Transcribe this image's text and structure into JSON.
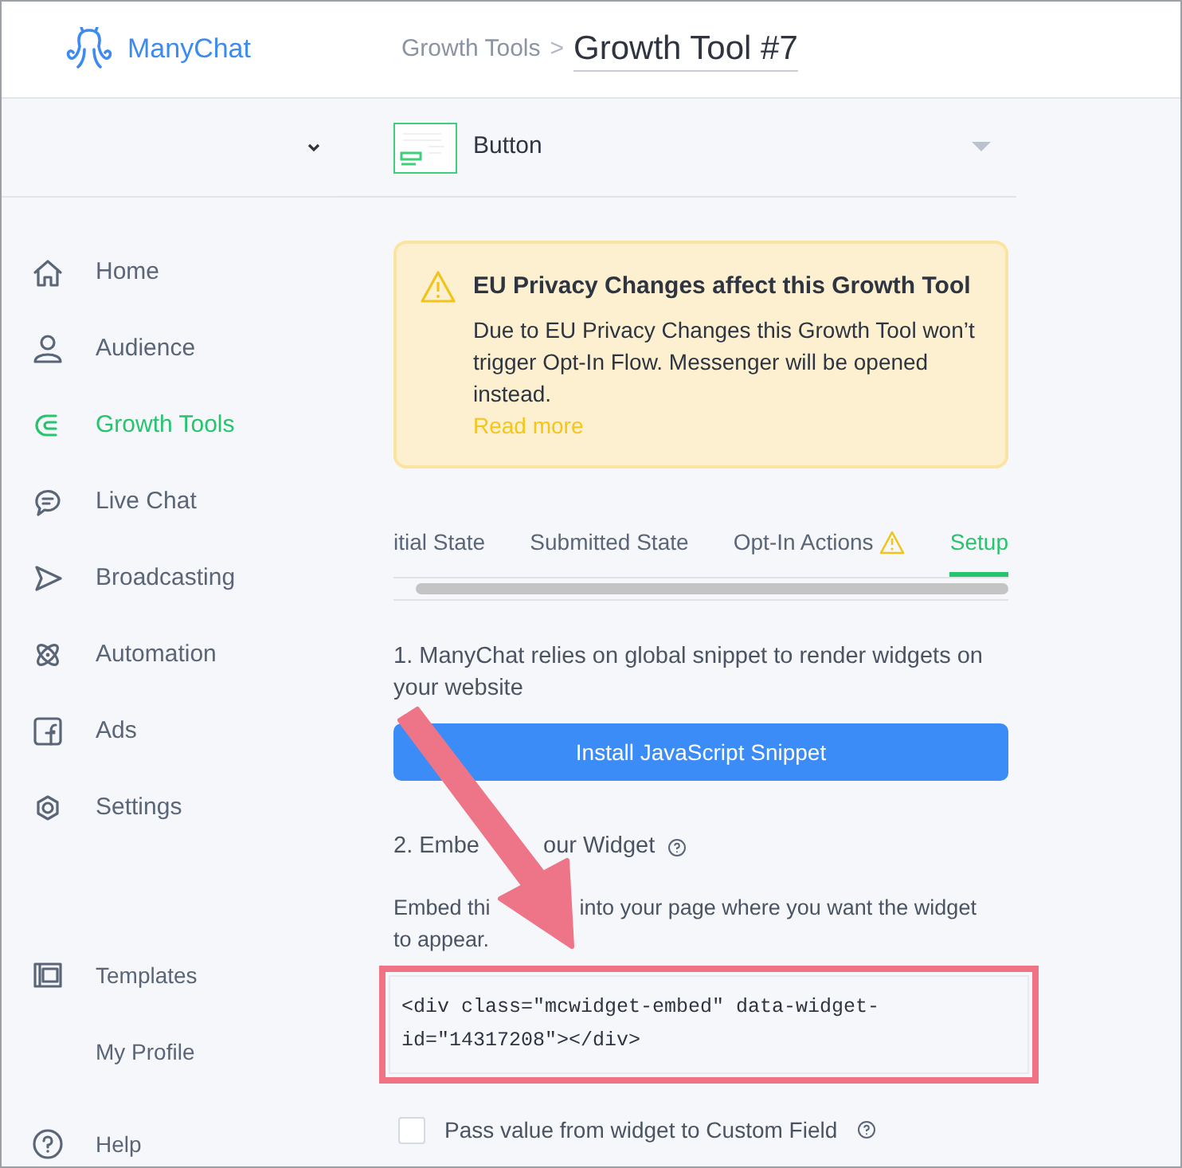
{
  "logo": {
    "text": "ManyChat"
  },
  "breadcrumb": {
    "parent": "Growth Tools",
    "separator": ">",
    "title": "Growth Tool #7"
  },
  "sidebar": {
    "items": [
      {
        "kind": "home",
        "label": "Home",
        "selected": false
      },
      {
        "kind": "audience",
        "label": "Audience",
        "selected": false
      },
      {
        "kind": "growth",
        "label": "Growth Tools",
        "selected": true
      },
      {
        "kind": "chat",
        "label": "Live Chat",
        "selected": false
      },
      {
        "kind": "broadcast",
        "label": "Broadcasting",
        "selected": false
      },
      {
        "kind": "automation",
        "label": "Automation",
        "selected": false
      },
      {
        "kind": "ads",
        "label": "Ads",
        "selected": false
      },
      {
        "kind": "settings",
        "label": "Settings",
        "selected": false
      }
    ],
    "bottom_items": [
      {
        "kind": "templates",
        "label": "Templates"
      },
      {
        "kind": "profile",
        "label": "My Profile"
      },
      {
        "kind": "help",
        "label": "Help"
      }
    ]
  },
  "widget_type": {
    "label": "Button"
  },
  "alert": {
    "title": "EU Privacy Changes affect this Growth Tool",
    "body": "Due to EU Privacy Changes this Growth Tool won’t trigger Opt-In Flow. Messenger will be opened instead.",
    "link": "Read more"
  },
  "tabs": [
    {
      "label": "itial State",
      "selected": false,
      "warning": false
    },
    {
      "label": "Submitted State",
      "selected": false,
      "warning": false
    },
    {
      "label": "Opt-In Actions",
      "selected": false,
      "warning": true
    },
    {
      "label": "Setup",
      "selected": true,
      "warning": false
    }
  ],
  "setup": {
    "step1": "1. ManyChat relies on global snippet to render widgets on your website",
    "install_button": "Install JavaScript Snippet",
    "step2_parts": [
      "2. Embe",
      "our Widget"
    ],
    "step2_text_parts": [
      "Embed thi",
      "into your page where you want the widget",
      "to appear."
    ],
    "code": "<div class=\"mcwidget-embed\" data-widget-id=\"14317208\"></div>",
    "pass_value": {
      "label": "Pass value from widget to Custom Field",
      "checked": false
    }
  }
}
